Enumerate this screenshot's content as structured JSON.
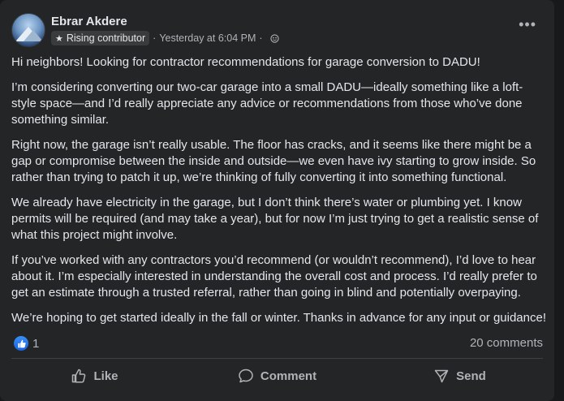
{
  "post": {
    "author": "Ebrar Akdere",
    "badge": "Rising contributor",
    "timestamp": "Yesterday at 6:04 PM",
    "separator": "·",
    "paragraphs": [
      "Hi neighbors! Looking for contractor recommendations for garage conversion to DADU!",
      "I’m considering converting our two-car garage into a small DADU—ideally something like a loft-style space—and I’d really appreciate any advice or recommendations from those who’ve done something similar.",
      "Right now, the garage isn’t really usable. The floor has cracks, and it seems like there might be a gap or compromise between the inside and outside—we even have ivy starting to grow inside. So rather than trying to patch it up, we’re thinking of fully converting it into something functional.",
      "We already have electricity in the garage, but I don’t think there’s water or plumbing yet. I know permits will be required (and may take a year), but for now I’m just trying to get a realistic sense of what this project might involve.",
      "If you’ve worked with any contractors you’d recommend (or wouldn’t recommend), I’d love to hear about it. I’m especially interested in understanding the overall cost and process. I’d really prefer to get an estimate through a trusted referral, rather than going in blind and potentially overpaying.",
      "We’re hoping to get started ideally in the fall or winter. Thanks in advance for any input or guidance!"
    ]
  },
  "stats": {
    "likes": "1",
    "comments": "20 comments"
  },
  "actions": {
    "like": "Like",
    "comment": "Comment",
    "send": "Send"
  },
  "icons": [
    "avatar",
    "star-icon",
    "globe-icon",
    "more-options-icon",
    "like-reaction-icon",
    "thumbs-up-icon",
    "comment-icon",
    "send-icon"
  ],
  "colors": {
    "accent": "#1877f2",
    "card": "#242526",
    "text": "#e4e6eb",
    "muted": "#b0b3b8"
  }
}
